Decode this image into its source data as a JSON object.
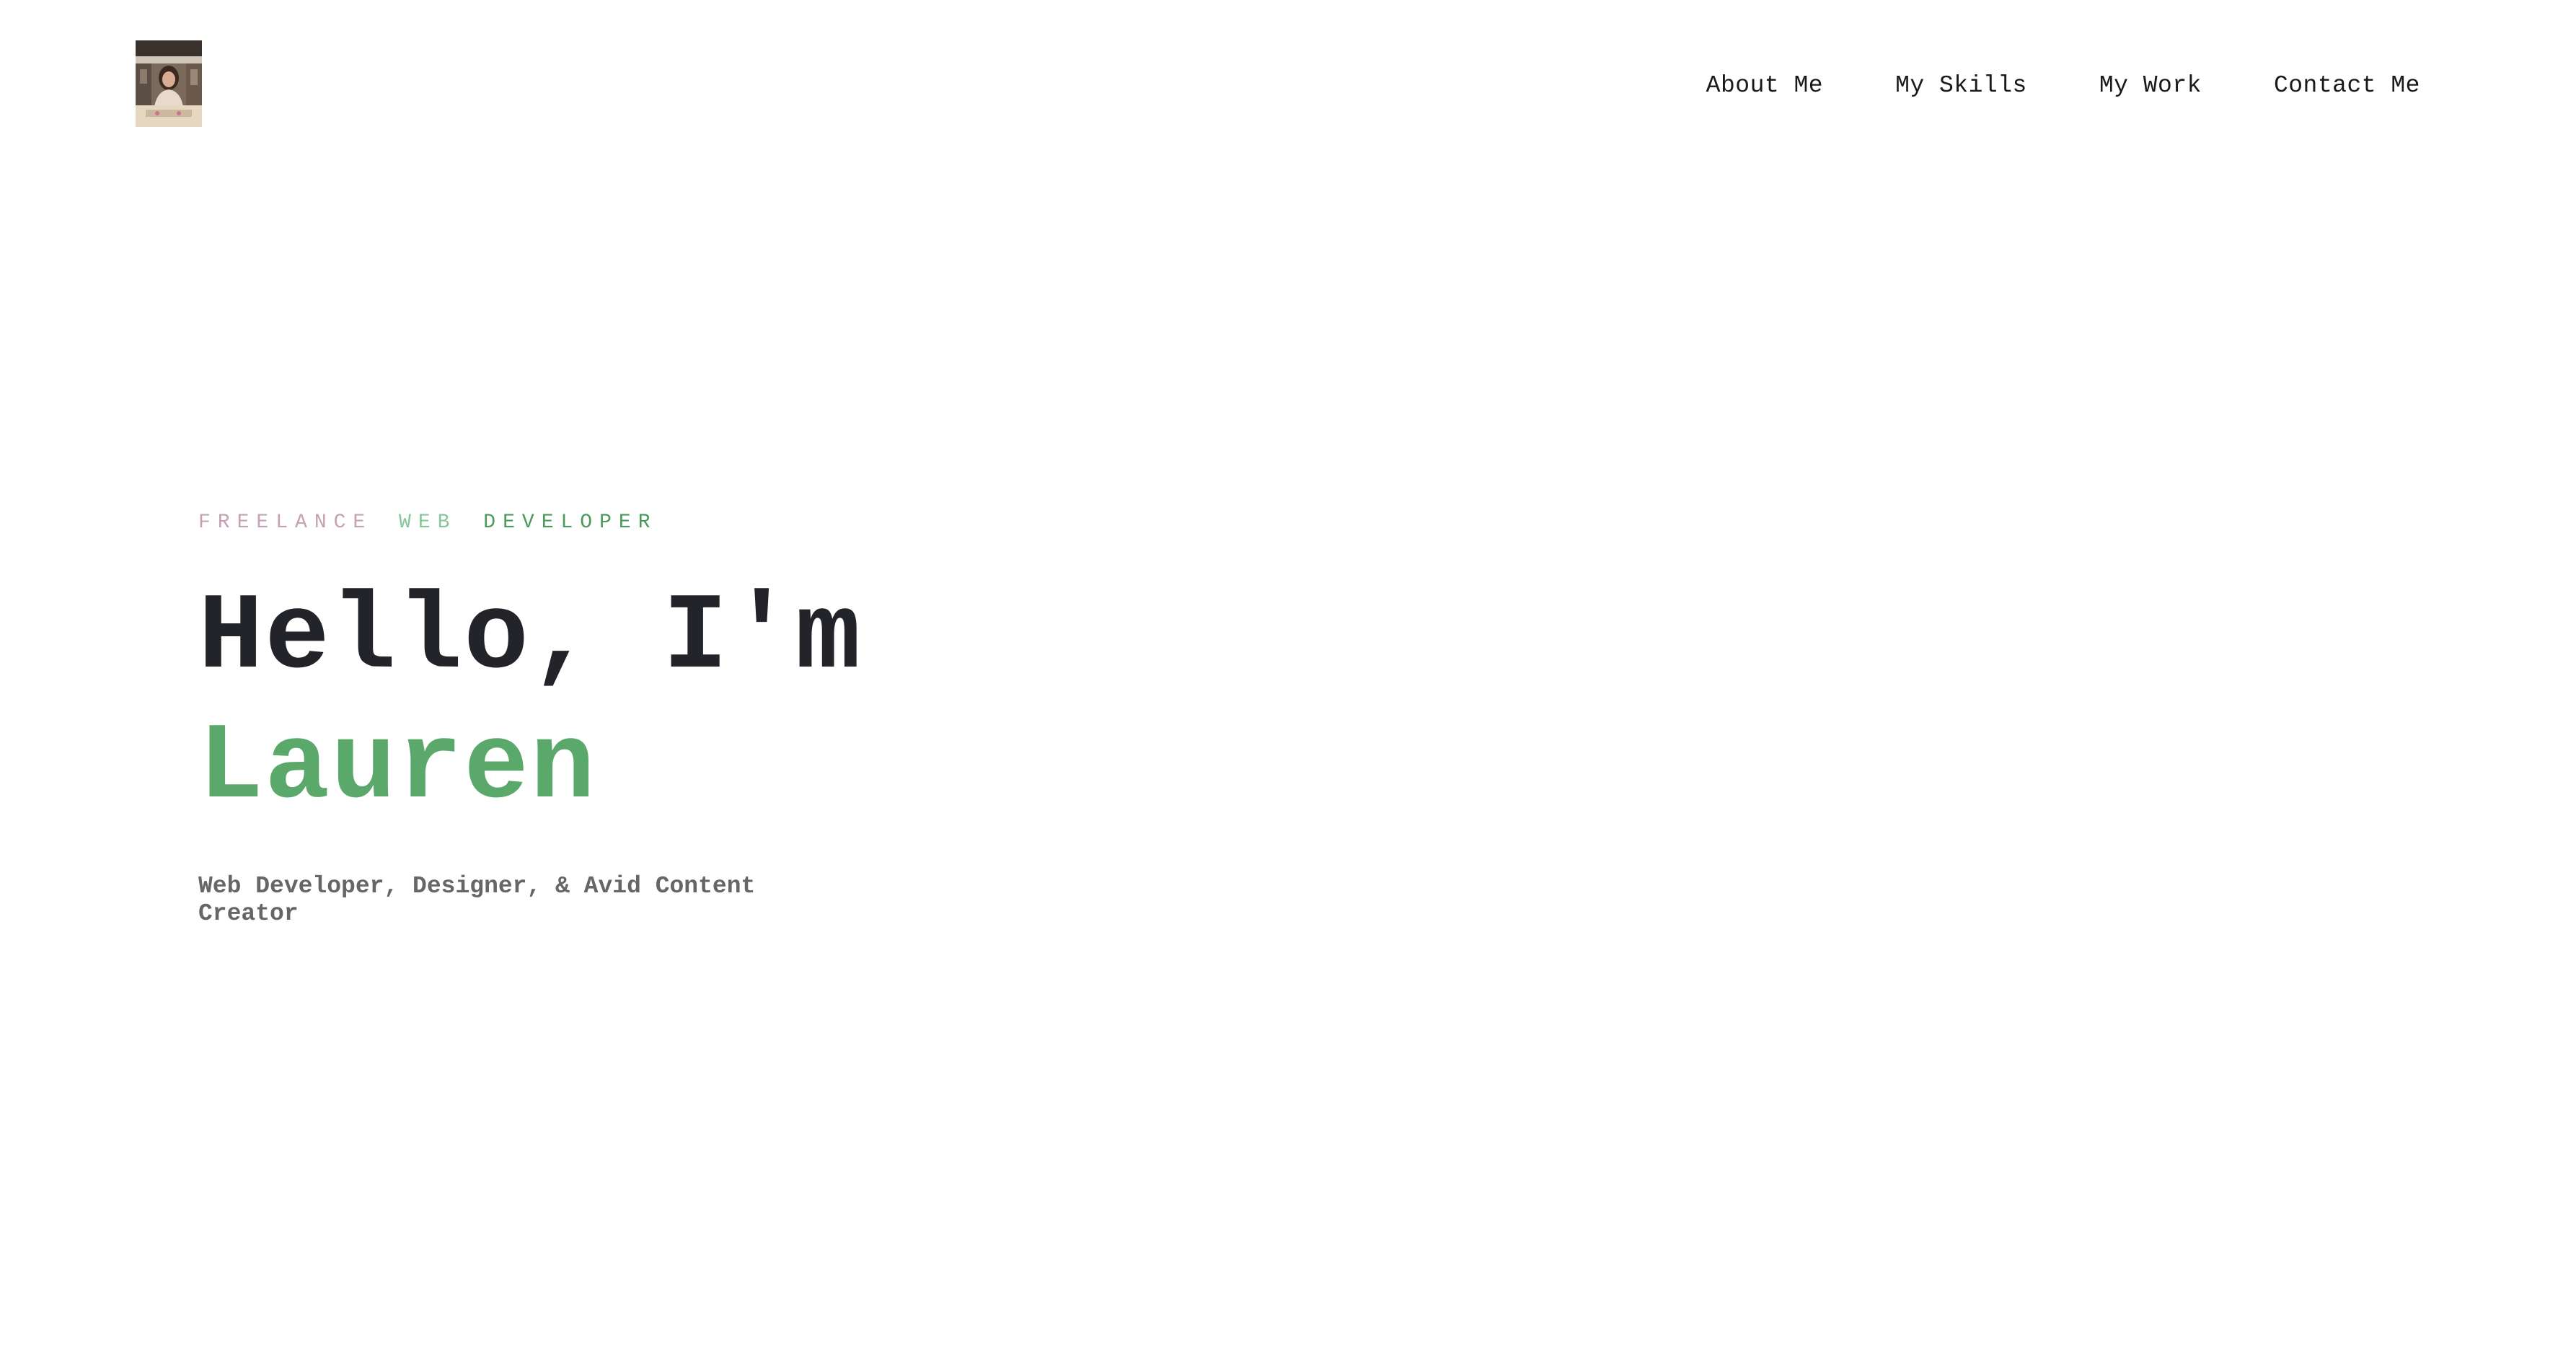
{
  "header": {
    "logo": {
      "alt": "Lauren portrait",
      "icon": "avatar-photo"
    },
    "nav": [
      {
        "label": "About Me"
      },
      {
        "label": "My Skills"
      },
      {
        "label": "My Work"
      },
      {
        "label": "Contact Me"
      }
    ]
  },
  "hero": {
    "tagline": {
      "word1": "FREELANCE",
      "word2": "WEB",
      "word3": "DEVELOPER"
    },
    "greeting": "Hello, I'm",
    "name": "Lauren",
    "subtitle": "Web Developer, Designer, & Avid Content Creator"
  },
  "colors": {
    "background": "#ffffff",
    "heading": "#23232a",
    "accent_green": "#5aa96a",
    "tag_pink": "#c4a1b4",
    "tag_light_green": "#86c799",
    "tag_green": "#4a9a5e",
    "subtitle_gray": "#666666",
    "nav_text": "#1a1a1a"
  }
}
